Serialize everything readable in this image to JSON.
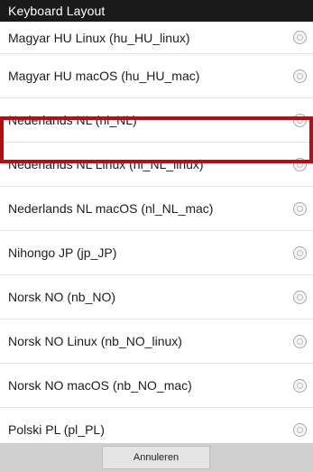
{
  "dialog": {
    "title": "Keyboard Layout"
  },
  "layouts": [
    {
      "label": "Magyar HU Linux (hu_HU_linux)"
    },
    {
      "label": "Magyar HU macOS (hu_HU_mac)"
    },
    {
      "label": "Nederlands NL (nl_NL)"
    },
    {
      "label": "Nederlands NL Linux (nl_NL_linux)"
    },
    {
      "label": "Nederlands NL macOS (nl_NL_mac)"
    },
    {
      "label": "Nihongo JP (jp_JP)"
    },
    {
      "label": "Norsk NO (nb_NO)"
    },
    {
      "label": "Norsk NO Linux (nb_NO_linux)"
    },
    {
      "label": "Norsk NO macOS (nb_NO_mac)"
    },
    {
      "label": "Polski PL (pl_PL)"
    }
  ],
  "footer": {
    "cancel_label": "Annuleren"
  },
  "colors": {
    "highlight": "#b50d13",
    "titlebar": "#1a1a1a"
  }
}
